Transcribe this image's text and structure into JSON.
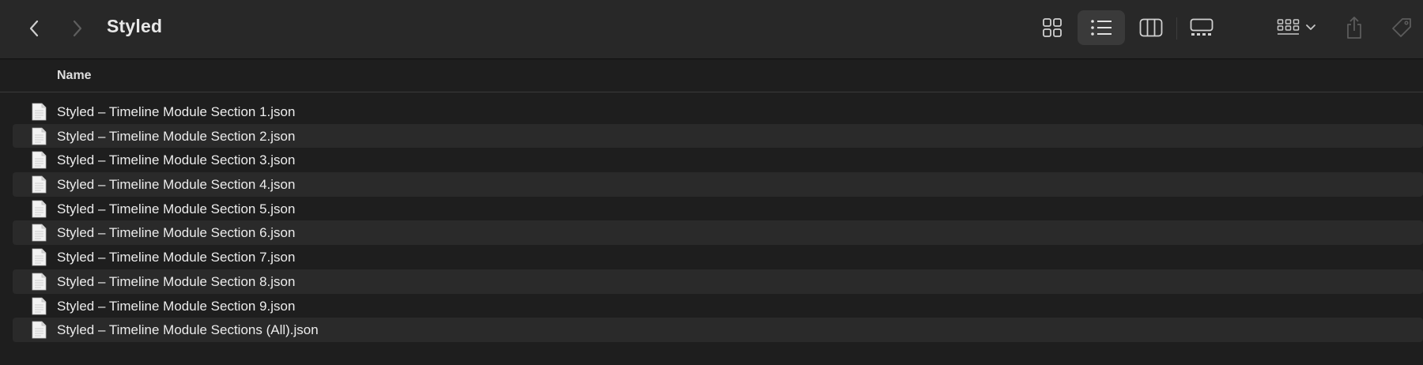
{
  "window": {
    "title": "Styled"
  },
  "toolbar": {
    "back_icon": "chevron-left-icon",
    "forward_icon": "chevron-right-icon",
    "view_modes": [
      "icons",
      "list",
      "columns",
      "gallery"
    ],
    "active_view": "list",
    "group_icon": "group-by-icon",
    "share_icon": "share-icon",
    "tags_icon": "tag-icon"
  },
  "columns": {
    "name": "Name"
  },
  "files": [
    {
      "name": "Styled – Timeline Module Section 1.json"
    },
    {
      "name": "Styled – Timeline Module Section 2.json"
    },
    {
      "name": "Styled – Timeline Module Section 3.json"
    },
    {
      "name": "Styled – Timeline Module Section 4.json"
    },
    {
      "name": "Styled – Timeline Module Section 5.json"
    },
    {
      "name": "Styled – Timeline Module Section 6.json"
    },
    {
      "name": "Styled – Timeline Module Section 7.json"
    },
    {
      "name": "Styled – Timeline Module Section 8.json"
    },
    {
      "name": "Styled – Timeline Module Section 9.json"
    },
    {
      "name": "Styled – Timeline Module Sections (All).json"
    }
  ],
  "colors": {
    "background": "#1e1e1e",
    "toolbar": "#282828",
    "row_alt": "#2a2a2a",
    "active_button": "#3a3a3a",
    "text": "#ececec"
  }
}
